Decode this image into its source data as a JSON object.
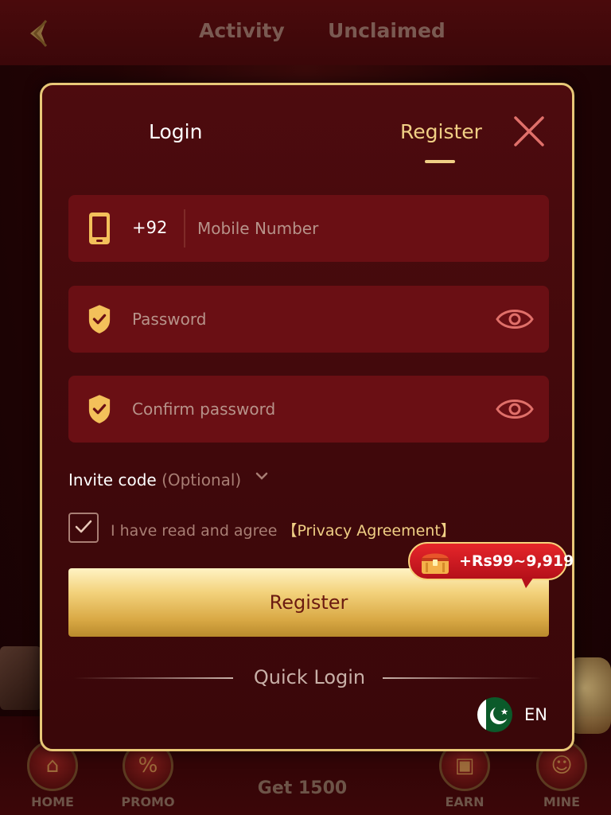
{
  "header": {
    "back_icon": "back-arrow-icon",
    "tabs": [
      {
        "label": "Activity"
      },
      {
        "label": "Unclaimed"
      }
    ]
  },
  "modal": {
    "tabs": {
      "login": "Login",
      "register": "Register",
      "active": "Register"
    },
    "close_icon": "close-icon",
    "phone_field": {
      "icon": "phone-icon",
      "country_code": "+92",
      "placeholder": "Mobile Number",
      "value": ""
    },
    "password_field": {
      "icon": "shield-check-icon",
      "placeholder": "Password",
      "value": "",
      "toggle_icon": "eye-icon"
    },
    "confirm_field": {
      "icon": "shield-check-icon",
      "placeholder": "Confirm password",
      "value": "",
      "toggle_icon": "eye-icon"
    },
    "invite": {
      "label": "Invite code",
      "optional": "(Optional)"
    },
    "agreement": {
      "checked": true,
      "text": "I have read and agree",
      "link": "【Privacy Agreement】"
    },
    "register_button": "Register",
    "reward_badge": {
      "icon": "treasure-chest-icon",
      "text": "+Rs99~9,919"
    },
    "quick_login": "Quick Login",
    "language": {
      "flag": "pakistan-flag-icon",
      "code": "EN"
    }
  },
  "bottom_nav": {
    "items": [
      {
        "label": "HOME"
      },
      {
        "label": "PROMO"
      },
      {
        "label": "Get 1500"
      },
      {
        "label": "EARN"
      },
      {
        "label": "MINE"
      }
    ]
  },
  "colors": {
    "accent_gold": "#f0cf85",
    "modal_border": "#e8c878",
    "field_bg": "#6a0f14",
    "badge_red": "#d41c22"
  }
}
